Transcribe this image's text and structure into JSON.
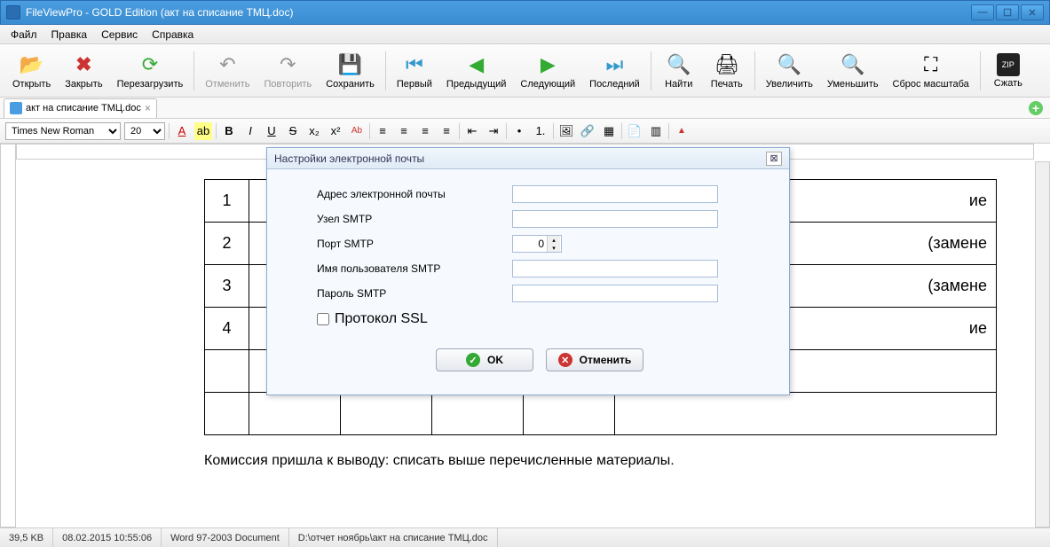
{
  "window": {
    "title": "FileViewPro - GOLD Edition (акт на списание ТМЦ.doc)"
  },
  "menu": {
    "file": "Файл",
    "edit": "Правка",
    "service": "Сервис",
    "help": "Справка"
  },
  "toolbar": {
    "open": "Открыть",
    "close": "Закрыть",
    "reload": "Перезагрузить",
    "undo": "Отменить",
    "redo": "Повторить",
    "save": "Сохранить",
    "first": "Первый",
    "prev": "Предыдущий",
    "next": "Следующий",
    "last": "Последний",
    "find": "Найти",
    "print": "Печать",
    "zoom_in": "Увеличить",
    "zoom_out": "Уменьшить",
    "zoom_reset": "Сброс масштаба",
    "compress": "Сжать"
  },
  "tab": {
    "name": "акт на списание ТМЦ.doc"
  },
  "format": {
    "font": "Times New Roman",
    "size": "20"
  },
  "doc": {
    "rows": [
      "1",
      "2",
      "3",
      "4"
    ],
    "col2a": "ие",
    "col2b": "(замене",
    "col2c": "(замене",
    "col2d": "ие",
    "conclusion": "Комиссия пришла к выводу: списать выше перечисленные материалы."
  },
  "dialog": {
    "title": "Настройки электронной почты",
    "email_label": "Адрес электронной почты",
    "smtp_host_label": "Узел SMTP",
    "smtp_port_label": "Порт SMTP",
    "smtp_port_value": "0",
    "smtp_user_label": "Имя пользователя SMTP",
    "smtp_pass_label": "Пароль SMTP",
    "ssl_label": "Протокол SSL",
    "ok": "OK",
    "cancel": "Отменить"
  },
  "status": {
    "size": "39,5 KB",
    "datetime": "08.02.2015 10:55:06",
    "type": "Word 97-2003 Document",
    "path": "D:\\отчет  ноябрь\\акт на списание ТМЦ.doc"
  }
}
